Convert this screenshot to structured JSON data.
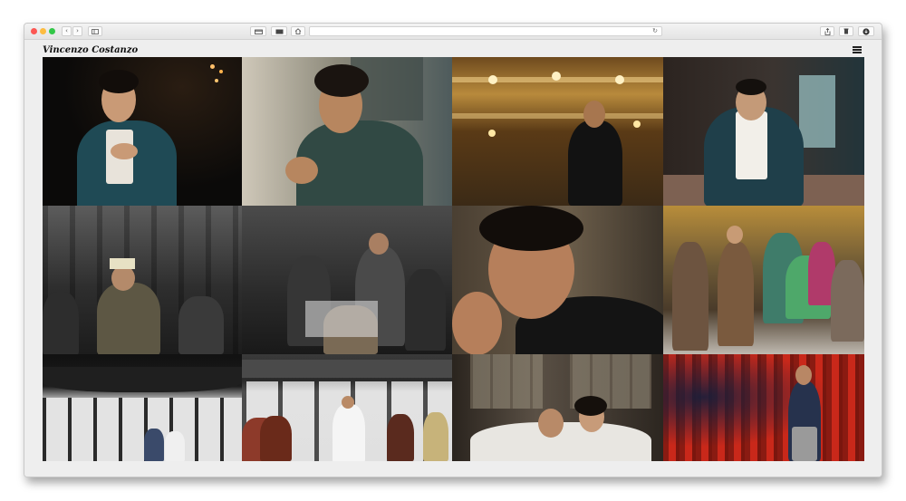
{
  "browser": {
    "nav_back": "‹",
    "nav_forward": "›",
    "reload_icon": "↻"
  },
  "site": {
    "title": "Vincenzo Costanzo"
  },
  "gallery": {
    "tiles": [
      {
        "name": "portrait-blue-suit-dark"
      },
      {
        "name": "portrait-green-sweater-harbor"
      },
      {
        "name": "portrait-opera-house-boxes"
      },
      {
        "name": "portrait-white-shirt-window"
      },
      {
        "name": "stage-soldiers-crowned-king"
      },
      {
        "name": "stage-soldiers-battle-scene"
      },
      {
        "name": "portrait-black-turtleneck-closeup"
      },
      {
        "name": "stage-costumed-ensemble"
      },
      {
        "name": "stage-japanese-house"
      },
      {
        "name": "stage-japanese-chorus"
      },
      {
        "name": "stage-couple-embrace"
      },
      {
        "name": "stage-red-curtain-singer"
      }
    ]
  }
}
